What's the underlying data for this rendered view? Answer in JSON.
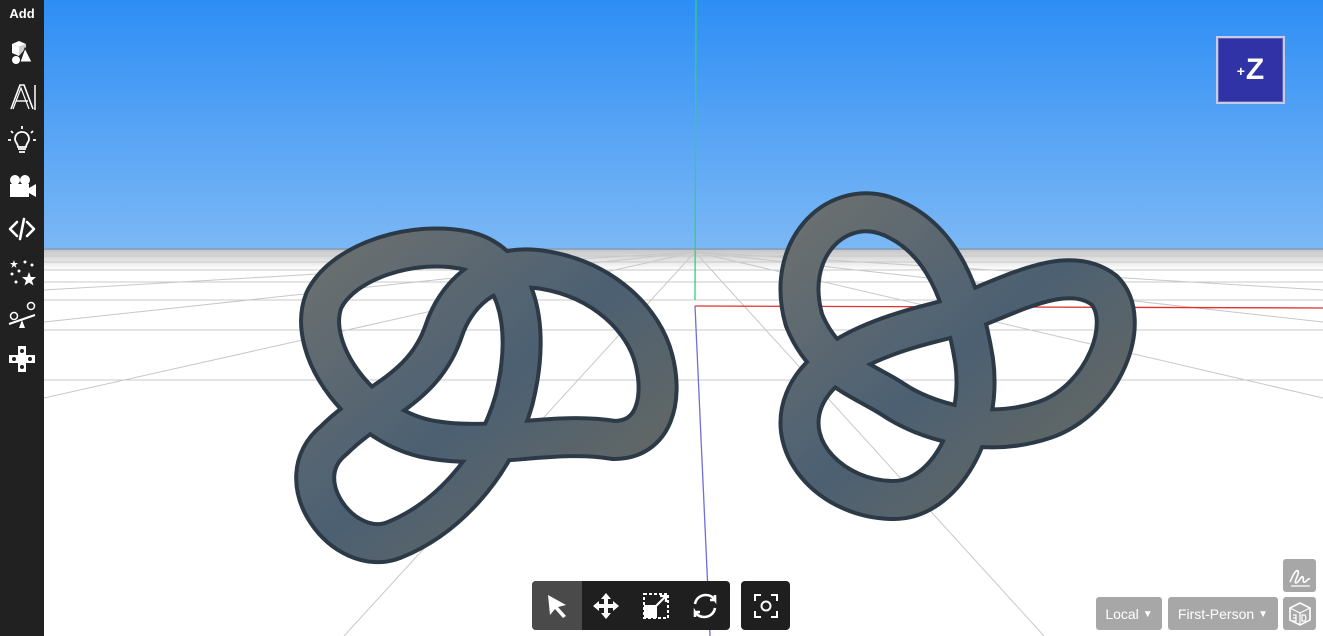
{
  "sidebar": {
    "title": "Add",
    "tools": [
      {
        "name": "shapes",
        "icon": "primitives-icon"
      },
      {
        "name": "text",
        "icon": "text-icon"
      },
      {
        "name": "lights",
        "icon": "lightbulb-icon"
      },
      {
        "name": "camera",
        "icon": "video-camera-icon"
      },
      {
        "name": "code",
        "icon": "code-icon"
      },
      {
        "name": "particles",
        "icon": "sparkles-icon"
      },
      {
        "name": "physics",
        "icon": "seesaw-icon"
      },
      {
        "name": "controls",
        "icon": "dpad-icon"
      }
    ]
  },
  "viewport": {
    "sky_top_color": "#2e8ef5",
    "sky_bottom_color": "#7cb8f5",
    "ground_color": "#ffffff",
    "grid_color": "#c8c8c8",
    "axis_x_color": "#e03030",
    "axis_y_color": "#2fd27a",
    "axis_z_color": "#6e6ee0",
    "knot_color": "#4f6170",
    "view_cube_label": "Z",
    "view_cube_sign": "+",
    "view_cube_color": "#2f33a6"
  },
  "toolbar": {
    "tools": [
      {
        "name": "select",
        "icon": "cursor-arrow-icon",
        "active": true
      },
      {
        "name": "move",
        "icon": "move-arrows-icon",
        "active": false
      },
      {
        "name": "scale",
        "icon": "scale-icon",
        "active": false
      },
      {
        "name": "rotate",
        "icon": "rotate-icon",
        "active": false
      }
    ],
    "focus_icon": "focus-target-icon"
  },
  "bottom_right": {
    "space_select": "Local",
    "camera_select": "First-Person",
    "draw_icon": "signature-icon",
    "mode_icon": "cube-3d-icon"
  }
}
